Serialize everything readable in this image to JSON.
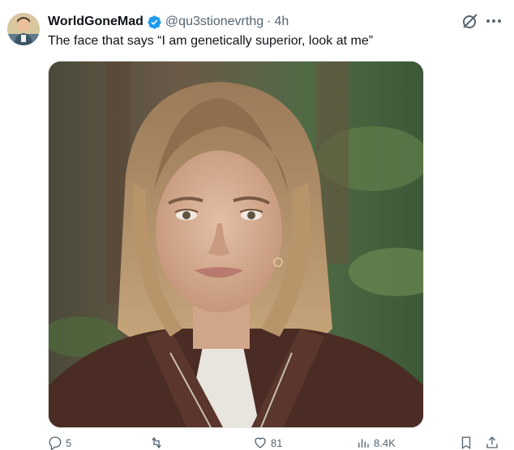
{
  "tweet": {
    "display_name": "WorldGoneMad",
    "handle": "@qu3stionevrthg",
    "separator": "·",
    "time": "4h",
    "text": "The face that says “I am genetically superior, look at me”"
  },
  "icons": {
    "avatar": "avatar-illustration",
    "verified": "verified-badge-icon",
    "grok": "grok-icon",
    "more": "more-icon",
    "reply": "reply-icon",
    "retweet": "retweet-icon",
    "like": "like-icon",
    "views": "views-icon",
    "bookmark": "bookmark-icon",
    "share": "share-icon"
  },
  "actions": {
    "reply_count": "5",
    "like_count": "81",
    "views_count": "8.4K"
  },
  "colors": {
    "verified_blue": "#1d9bf0",
    "secondary_text": "#536471",
    "primary_text": "#0f1419"
  }
}
